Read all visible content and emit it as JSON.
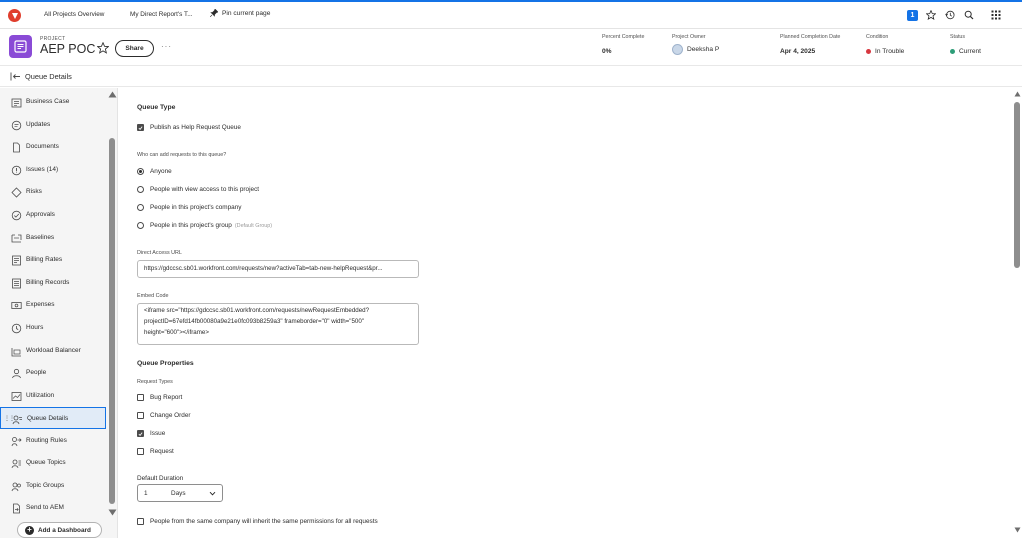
{
  "nav": {
    "tab1": "All Projects Overview",
    "tab2": "My Direct Report's T...",
    "pin": "Pin current page",
    "badge_count": "1"
  },
  "project": {
    "label": "PROJECT",
    "name": "AEP POC",
    "share": "Share",
    "more": "···",
    "meta": {
      "percent_label": "Percent Complete",
      "percent_value": "0%",
      "owner_label": "Project Owner",
      "owner_value": "Deeksha P",
      "planned_label": "Planned Completion Date",
      "planned_value": "Apr 4, 2025",
      "condition_label": "Condition",
      "condition_value": "In Trouble",
      "status_label": "Status",
      "status_value": "Current"
    }
  },
  "section": {
    "title": "Queue Details"
  },
  "colors": {
    "accent": "#1473e6",
    "danger": "#d7373f",
    "success": "#2d9d78",
    "project_icon": "#8a4bd6"
  },
  "sidebar": {
    "items": [
      {
        "label": "Business Case",
        "icon": "business-case-icon"
      },
      {
        "label": "Updates",
        "icon": "updates-icon"
      },
      {
        "label": "Documents",
        "icon": "documents-icon"
      },
      {
        "label": "Issues (14)",
        "icon": "issues-icon"
      },
      {
        "label": "Risks",
        "icon": "risks-icon"
      },
      {
        "label": "Approvals",
        "icon": "approvals-icon"
      },
      {
        "label": "Baselines",
        "icon": "baselines-icon"
      },
      {
        "label": "Billing Rates",
        "icon": "billing-rates-icon"
      },
      {
        "label": "Billing Records",
        "icon": "billing-records-icon"
      },
      {
        "label": "Expenses",
        "icon": "expenses-icon"
      },
      {
        "label": "Hours",
        "icon": "hours-icon"
      },
      {
        "label": "Workload Balancer",
        "icon": "workload-balancer-icon"
      },
      {
        "label": "People",
        "icon": "people-icon"
      },
      {
        "label": "Utilization",
        "icon": "utilization-icon"
      },
      {
        "label": "Queue Details",
        "icon": "queue-details-icon"
      },
      {
        "label": "Routing Rules",
        "icon": "routing-rules-icon"
      },
      {
        "label": "Queue Topics",
        "icon": "queue-topics-icon"
      },
      {
        "label": "Topic Groups",
        "icon": "topic-groups-icon"
      },
      {
        "label": "Send to AEM",
        "icon": "send-to-aem-icon"
      }
    ],
    "add_dashboard": "Add a Dashboard"
  },
  "main": {
    "queue_type_heading": "Queue Type",
    "publish_label": "Publish as Help Request Queue",
    "who_label": "Who can add requests to this queue?",
    "options": {
      "anyone": "Anyone",
      "view_access": "People with view access to this project",
      "company": "People in this project's company",
      "group": "People in this project's group",
      "group_hint": "(Default Group)"
    },
    "direct_url_label": "Direct Access URL",
    "direct_url_value": "https://gdccsc.sb01.workfront.com/requests/new?activeTab=tab-new-helpRequest&pr...",
    "embed_label": "Embed Code",
    "embed_line1": "<iframe src=\"https://gdccsc.sb01.workfront.com/requests/newRequestEmbedded?",
    "embed_line2": "projectID=67efd14fb00080a9e21e0fc093b8259a3\" frameborder=\"0\" width=\"500\"",
    "embed_line3": "height=\"600\"></iframe>",
    "queue_props_heading": "Queue Properties",
    "request_types_label": "Request Types",
    "request_types": {
      "bug": "Bug Report",
      "change": "Change Order",
      "issue": "Issue",
      "request": "Request"
    },
    "default_duration_label": "Default Duration",
    "duration_value": "1",
    "duration_unit": "Days",
    "inherit_label": "People from the same company will inherit the same permissions for all requests"
  }
}
